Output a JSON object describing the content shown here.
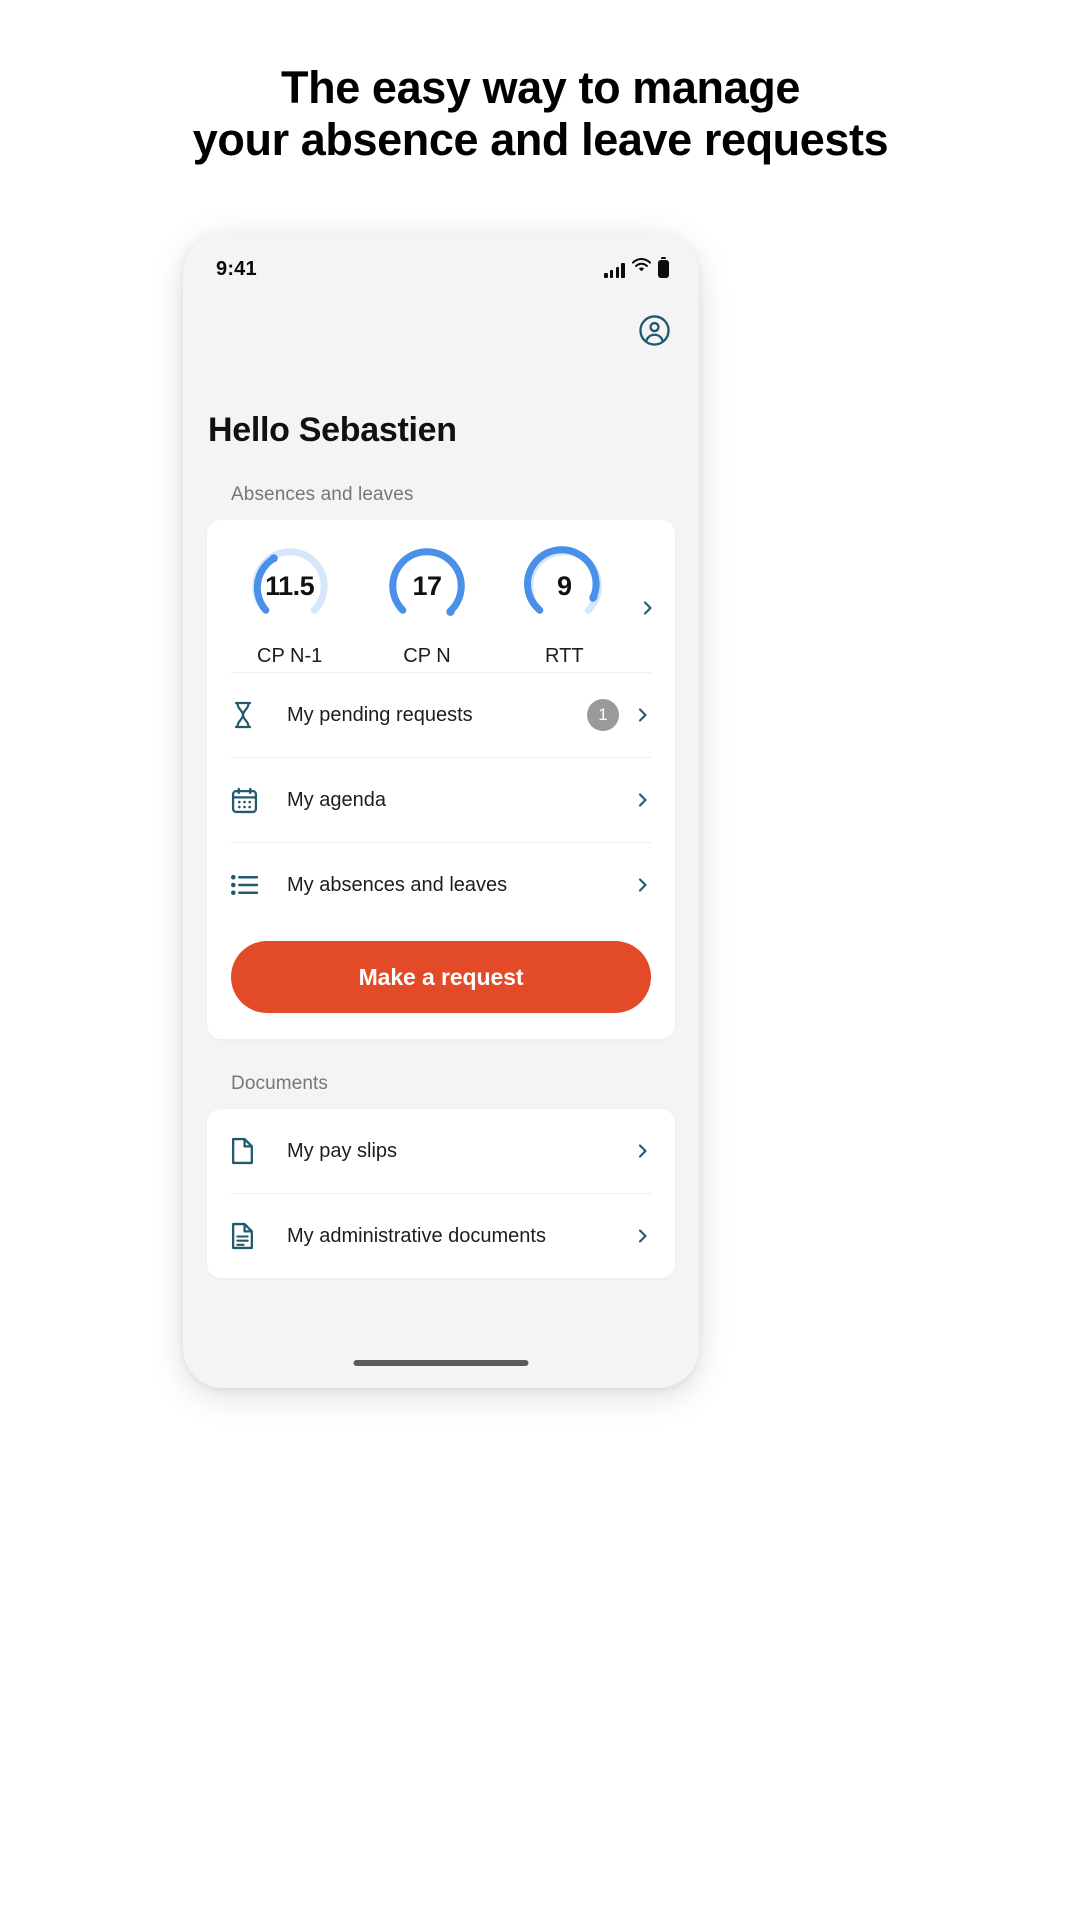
{
  "marketing": {
    "headline_line1": "The easy way to manage",
    "headline_line2": "your absence and leave requests"
  },
  "status_bar": {
    "time": "9:41",
    "signal_icon": "cellular-signal-icon",
    "wifi_icon": "wifi-icon",
    "battery_icon": "battery-icon"
  },
  "app": {
    "profile_icon": "account-circle-icon",
    "greeting": "Hello Sebastien"
  },
  "absences": {
    "section_label": "Absences and leaves",
    "chevron_icon": "chevron-right-icon",
    "gauges": [
      {
        "value": "11.5",
        "label": "CP N-1",
        "percent": 45,
        "accent": "#4a90e8",
        "track": "#d6e7fb"
      },
      {
        "value": "17",
        "label": "CP N",
        "percent": 97,
        "accent": "#4a90e8",
        "track": "#d6e7fb"
      },
      {
        "value": "9",
        "label": "RTT",
        "percent": 72,
        "accent": "#4a90e8",
        "track": "#d6e7fb"
      }
    ],
    "rows": [
      {
        "icon": "hourglass-icon",
        "label": "My pending requests",
        "badge": "1"
      },
      {
        "icon": "calendar-icon",
        "label": "My agenda",
        "badge": ""
      },
      {
        "icon": "list-icon",
        "label": "My absences and leaves",
        "badge": ""
      }
    ],
    "cta_label": "Make a request"
  },
  "documents": {
    "section_label": "Documents",
    "rows": [
      {
        "icon": "file-icon",
        "label": "My pay slips"
      },
      {
        "icon": "document-text-icon",
        "label": "My administrative documents"
      }
    ]
  },
  "colors": {
    "accent_blue": "#4a90e8",
    "gauge_track": "#d6e7fb",
    "icon_teal": "#23596e",
    "cta_orange": "#e24a28",
    "badge_gray": "#9a9a9a",
    "text_muted": "#767676"
  }
}
